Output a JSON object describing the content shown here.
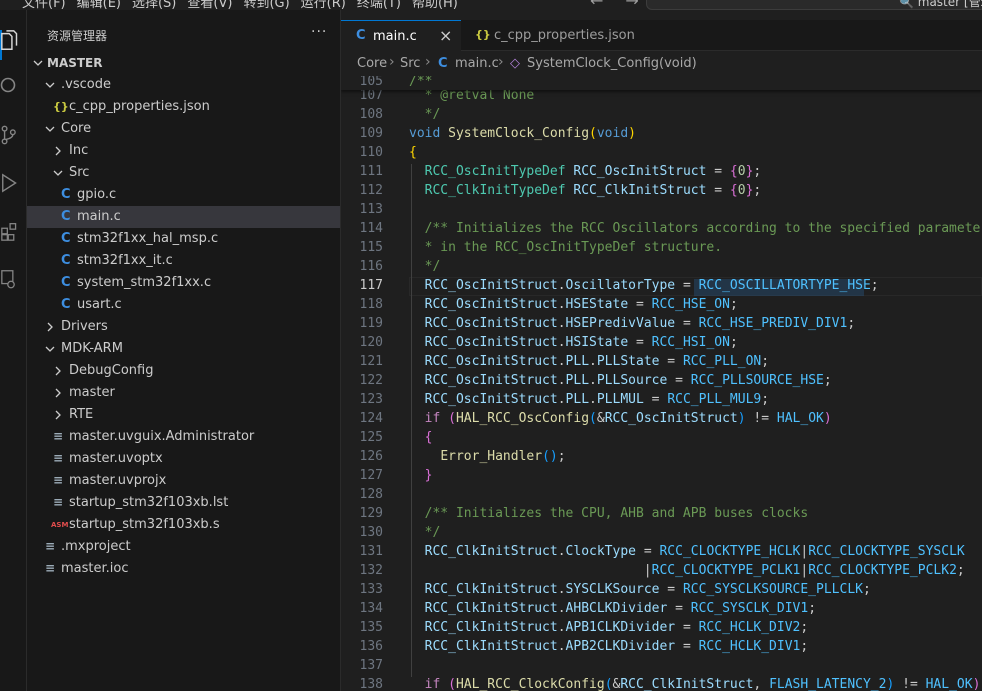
{
  "menu": [
    "文件(F)",
    "编辑(E)",
    "选择(S)",
    "查看(V)",
    "转到(G)",
    "运行(R)",
    "终端(T)",
    "帮助(H)"
  ],
  "nav": {
    "back": "←",
    "forward": "→"
  },
  "command_center": {
    "text": "🔍 master [管理"
  },
  "activity_bar": [
    "explorer-icon",
    "search-icon",
    "source-control-icon",
    "run-debug-icon",
    "extensions-icon",
    "remote-icon"
  ],
  "sidebar": {
    "title": "资源管理器",
    "more": "···",
    "root": "MASTER",
    "items": [
      {
        "label": ".vscode",
        "type": "folder-open",
        "depth": 1
      },
      {
        "label": "c_cpp_properties.json",
        "type": "json",
        "depth": 2,
        "icon": "{}"
      },
      {
        "label": "Core",
        "type": "folder-open",
        "depth": 1
      },
      {
        "label": "Inc",
        "type": "folder",
        "depth": 2
      },
      {
        "label": "Src",
        "type": "folder-open",
        "depth": 2
      },
      {
        "label": "gpio.c",
        "type": "c",
        "depth": 3,
        "icon": "C"
      },
      {
        "label": "main.c",
        "type": "c",
        "depth": 3,
        "icon": "C",
        "selected": true
      },
      {
        "label": "stm32f1xx_hal_msp.c",
        "type": "c",
        "depth": 3,
        "icon": "C"
      },
      {
        "label": "stm32f1xx_it.c",
        "type": "c",
        "depth": 3,
        "icon": "C"
      },
      {
        "label": "system_stm32f1xx.c",
        "type": "c",
        "depth": 3,
        "icon": "C"
      },
      {
        "label": "usart.c",
        "type": "c",
        "depth": 3,
        "icon": "C"
      },
      {
        "label": "Drivers",
        "type": "folder",
        "depth": 1
      },
      {
        "label": "MDK-ARM",
        "type": "folder-open",
        "depth": 1
      },
      {
        "label": "DebugConfig",
        "type": "folder",
        "depth": 2
      },
      {
        "label": "master",
        "type": "folder",
        "depth": 2
      },
      {
        "label": "RTE",
        "type": "folder",
        "depth": 2
      },
      {
        "label": "master.uvguix.Administrator",
        "type": "file",
        "depth": 2,
        "icon": "≡"
      },
      {
        "label": "master.uvoptx",
        "type": "file",
        "depth": 2,
        "icon": "≡"
      },
      {
        "label": "master.uvprojx",
        "type": "file",
        "depth": 2,
        "icon": "≡"
      },
      {
        "label": "startup_stm32f103xb.lst",
        "type": "file",
        "depth": 2,
        "icon": "≡"
      },
      {
        "label": "startup_stm32f103xb.s",
        "type": "asm",
        "depth": 2,
        "icon": "ASM"
      },
      {
        "label": ".mxproject",
        "type": "file",
        "depth": 1,
        "icon": "≡"
      },
      {
        "label": "master.ioc",
        "type": "file",
        "depth": 1,
        "icon": "≡"
      }
    ]
  },
  "tabs": [
    {
      "icon": "C",
      "label": "main.c",
      "close": "×",
      "active": true
    },
    {
      "icon": "{}",
      "label": "c_cpp_properties.json",
      "active": false
    }
  ],
  "breadcrumb": {
    "items": [
      "Core",
      "Src",
      "main.c",
      "SystemClock_Config(void)"
    ],
    "file_icon": "C",
    "symbol_icon": "◇",
    "separator": "›"
  },
  "editor": {
    "sticky_line": "105",
    "current_line": "117",
    "lines": [
      {
        "n": "105",
        "tokens": [
          [
            "c",
            "/**"
          ]
        ]
      },
      {
        "n": "107",
        "tokens": [
          [
            "c",
            "  * @retval None"
          ]
        ]
      },
      {
        "n": "108",
        "tokens": [
          [
            "c",
            "  */"
          ]
        ]
      },
      {
        "n": "109",
        "tokens": [
          [
            "k",
            "void"
          ],
          [
            "p",
            " "
          ],
          [
            "f",
            "SystemClock_Config"
          ],
          [
            "b1",
            "("
          ],
          [
            "k",
            "void"
          ],
          [
            "b1",
            ")"
          ]
        ]
      },
      {
        "n": "110",
        "tokens": [
          [
            "b1",
            "{"
          ]
        ]
      },
      {
        "n": "111",
        "tokens": [
          [
            "p",
            "  "
          ],
          [
            "t",
            "RCC_OscInitTypeDef"
          ],
          [
            "p",
            " "
          ],
          [
            "v",
            "RCC_OscInitStruct"
          ],
          [
            "p",
            " = "
          ],
          [
            "b2",
            "{"
          ],
          [
            "n",
            "0"
          ],
          [
            "b2",
            "}"
          ],
          [
            "p",
            ";"
          ]
        ]
      },
      {
        "n": "112",
        "tokens": [
          [
            "p",
            "  "
          ],
          [
            "t",
            "RCC_ClkInitTypeDef"
          ],
          [
            "p",
            " "
          ],
          [
            "v",
            "RCC_ClkInitStruct"
          ],
          [
            "p",
            " = "
          ],
          [
            "b2",
            "{"
          ],
          [
            "n",
            "0"
          ],
          [
            "b2",
            "}"
          ],
          [
            "p",
            ";"
          ]
        ]
      },
      {
        "n": "113",
        "tokens": []
      },
      {
        "n": "114",
        "tokens": [
          [
            "c",
            "  /** Initializes the RCC Oscillators according to the specified parameters"
          ]
        ]
      },
      {
        "n": "115",
        "tokens": [
          [
            "c",
            "  * in the RCC_OscInitTypeDef structure."
          ]
        ]
      },
      {
        "n": "116",
        "tokens": [
          [
            "c",
            "  */"
          ]
        ]
      },
      {
        "n": "117",
        "tokens": [
          [
            "p",
            "  "
          ],
          [
            "v",
            "RCC_OscInitStruct"
          ],
          [
            "p",
            "."
          ],
          [
            "v",
            "OscillatorType"
          ],
          [
            "p",
            " = "
          ],
          [
            "m",
            "RCC_OSCILLATORTYPE_HSE"
          ],
          [
            "p",
            ";"
          ]
        ]
      },
      {
        "n": "118",
        "tokens": [
          [
            "p",
            "  "
          ],
          [
            "v",
            "RCC_OscInitStruct"
          ],
          [
            "p",
            "."
          ],
          [
            "v",
            "HSEState"
          ],
          [
            "p",
            " = "
          ],
          [
            "m",
            "RCC_HSE_ON"
          ],
          [
            "p",
            ";"
          ]
        ]
      },
      {
        "n": "119",
        "tokens": [
          [
            "p",
            "  "
          ],
          [
            "v",
            "RCC_OscInitStruct"
          ],
          [
            "p",
            "."
          ],
          [
            "v",
            "HSEPredivValue"
          ],
          [
            "p",
            " = "
          ],
          [
            "m",
            "RCC_HSE_PREDIV_DIV1"
          ],
          [
            "p",
            ";"
          ]
        ]
      },
      {
        "n": "120",
        "tokens": [
          [
            "p",
            "  "
          ],
          [
            "v",
            "RCC_OscInitStruct"
          ],
          [
            "p",
            "."
          ],
          [
            "v",
            "HSIState"
          ],
          [
            "p",
            " = "
          ],
          [
            "m",
            "RCC_HSI_ON"
          ],
          [
            "p",
            ";"
          ]
        ]
      },
      {
        "n": "121",
        "tokens": [
          [
            "p",
            "  "
          ],
          [
            "v",
            "RCC_OscInitStruct"
          ],
          [
            "p",
            "."
          ],
          [
            "v",
            "PLL"
          ],
          [
            "p",
            "."
          ],
          [
            "v",
            "PLLState"
          ],
          [
            "p",
            " = "
          ],
          [
            "m",
            "RCC_PLL_ON"
          ],
          [
            "p",
            ";"
          ]
        ]
      },
      {
        "n": "122",
        "tokens": [
          [
            "p",
            "  "
          ],
          [
            "v",
            "RCC_OscInitStruct"
          ],
          [
            "p",
            "."
          ],
          [
            "v",
            "PLL"
          ],
          [
            "p",
            "."
          ],
          [
            "v",
            "PLLSource"
          ],
          [
            "p",
            " = "
          ],
          [
            "m",
            "RCC_PLLSOURCE_HSE"
          ],
          [
            "p",
            ";"
          ]
        ]
      },
      {
        "n": "123",
        "tokens": [
          [
            "p",
            "  "
          ],
          [
            "v",
            "RCC_OscInitStruct"
          ],
          [
            "p",
            "."
          ],
          [
            "v",
            "PLL"
          ],
          [
            "p",
            "."
          ],
          [
            "v",
            "PLLMUL"
          ],
          [
            "p",
            " = "
          ],
          [
            "m",
            "RCC_PLL_MUL9"
          ],
          [
            "p",
            ";"
          ]
        ]
      },
      {
        "n": "124",
        "tokens": [
          [
            "p",
            "  "
          ],
          [
            "ctrl",
            "if"
          ],
          [
            "p",
            " "
          ],
          [
            "b2",
            "("
          ],
          [
            "f",
            "HAL_RCC_OscConfig"
          ],
          [
            "b3",
            "("
          ],
          [
            "p",
            "&"
          ],
          [
            "v",
            "RCC_OscInitStruct"
          ],
          [
            "b3",
            ")"
          ],
          [
            "p",
            " != "
          ],
          [
            "m",
            "HAL_OK"
          ],
          [
            "b2",
            ")"
          ]
        ]
      },
      {
        "n": "125",
        "tokens": [
          [
            "p",
            "  "
          ],
          [
            "b2",
            "{"
          ]
        ]
      },
      {
        "n": "126",
        "tokens": [
          [
            "p",
            "    "
          ],
          [
            "f",
            "Error_Handler"
          ],
          [
            "b3",
            "()"
          ],
          [
            "p",
            ";"
          ]
        ]
      },
      {
        "n": "127",
        "tokens": [
          [
            "p",
            "  "
          ],
          [
            "b2",
            "}"
          ]
        ]
      },
      {
        "n": "128",
        "tokens": []
      },
      {
        "n": "129",
        "tokens": [
          [
            "c",
            "  /** Initializes the CPU, AHB and APB buses clocks"
          ]
        ]
      },
      {
        "n": "130",
        "tokens": [
          [
            "c",
            "  */"
          ]
        ]
      },
      {
        "n": "131",
        "tokens": [
          [
            "p",
            "  "
          ],
          [
            "v",
            "RCC_ClkInitStruct"
          ],
          [
            "p",
            "."
          ],
          [
            "v",
            "ClockType"
          ],
          [
            "p",
            " = "
          ],
          [
            "m",
            "RCC_CLOCKTYPE_HCLK"
          ],
          [
            "p",
            "|"
          ],
          [
            "m",
            "RCC_CLOCKTYPE_SYSCLK"
          ]
        ]
      },
      {
        "n": "132",
        "tokens": [
          [
            "p",
            "                              |"
          ],
          [
            "m",
            "RCC_CLOCKTYPE_PCLK1"
          ],
          [
            "p",
            "|"
          ],
          [
            "m",
            "RCC_CLOCKTYPE_PCLK2"
          ],
          [
            "p",
            ";"
          ]
        ]
      },
      {
        "n": "133",
        "tokens": [
          [
            "p",
            "  "
          ],
          [
            "v",
            "RCC_ClkInitStruct"
          ],
          [
            "p",
            "."
          ],
          [
            "v",
            "SYSCLKSource"
          ],
          [
            "p",
            " = "
          ],
          [
            "m",
            "RCC_SYSCLKSOURCE_PLLCLK"
          ],
          [
            "p",
            ";"
          ]
        ]
      },
      {
        "n": "134",
        "tokens": [
          [
            "p",
            "  "
          ],
          [
            "v",
            "RCC_ClkInitStruct"
          ],
          [
            "p",
            "."
          ],
          [
            "v",
            "AHBCLKDivider"
          ],
          [
            "p",
            " = "
          ],
          [
            "m",
            "RCC_SYSCLK_DIV1"
          ],
          [
            "p",
            ";"
          ]
        ]
      },
      {
        "n": "135",
        "tokens": [
          [
            "p",
            "  "
          ],
          [
            "v",
            "RCC_ClkInitStruct"
          ],
          [
            "p",
            "."
          ],
          [
            "v",
            "APB1CLKDivider"
          ],
          [
            "p",
            " = "
          ],
          [
            "m",
            "RCC_HCLK_DIV2"
          ],
          [
            "p",
            ";"
          ]
        ]
      },
      {
        "n": "136",
        "tokens": [
          [
            "p",
            "  "
          ],
          [
            "v",
            "RCC_ClkInitStruct"
          ],
          [
            "p",
            "."
          ],
          [
            "v",
            "APB2CLKDivider"
          ],
          [
            "p",
            " = "
          ],
          [
            "m",
            "RCC_HCLK_DIV1"
          ],
          [
            "p",
            ";"
          ]
        ]
      },
      {
        "n": "137",
        "tokens": []
      },
      {
        "n": "138",
        "tokens": [
          [
            "p",
            "  "
          ],
          [
            "ctrl",
            "if"
          ],
          [
            "p",
            " "
          ],
          [
            "b2",
            "("
          ],
          [
            "f",
            "HAL_RCC_ClockConfig"
          ],
          [
            "b3",
            "("
          ],
          [
            "p",
            "&"
          ],
          [
            "v",
            "RCC_ClkInitStruct"
          ],
          [
            "p",
            ", "
          ],
          [
            "m",
            "FLASH_LATENCY_2"
          ],
          [
            "b3",
            ")"
          ],
          [
            "p",
            " != "
          ],
          [
            "m",
            "HAL_OK"
          ],
          [
            "b2",
            ")"
          ]
        ]
      }
    ]
  },
  "colors": {
    "accent": "#0078d4",
    "background": "#1f1f1f",
    "sidebar": "#181818",
    "selection": "#37373d"
  }
}
